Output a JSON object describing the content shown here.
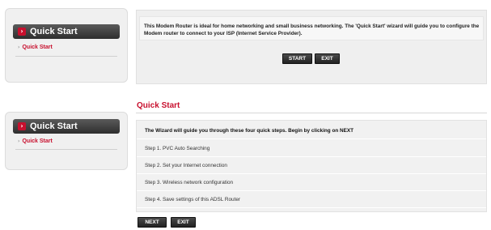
{
  "top": {
    "sidebar": {
      "header": "Quick Start",
      "items": [
        {
          "label": "Quick Start"
        }
      ]
    },
    "intro_text": "This Modem Router is ideal for home networking and small business networking. The 'Quick Start' wizard will guide you to configure the Modem router to connect to your ISP (Internet Service Provider).",
    "buttons": {
      "start": "START",
      "exit": "EXIT"
    }
  },
  "bottom": {
    "sidebar": {
      "header": "Quick Start",
      "items": [
        {
          "label": "Quick Start"
        }
      ]
    },
    "title": "Quick Start",
    "wizard_intro": "The Wizard will guide you through these four quick steps. Begin by clicking on NEXT",
    "steps": [
      "Step 1. PVC Auto Searching",
      "Step 2. Set your Internet connection",
      "Step 3. Wireless network configuration",
      "Step 4. Save settings of this ADSL Router"
    ],
    "buttons": {
      "next": "NEXT",
      "exit": "EXIT"
    }
  },
  "icons": {
    "arrow": "arrow-right-icon",
    "bullet": "bullet-icon"
  },
  "colors": {
    "accent_red": "#c8102e",
    "header_dark": "#2e2e2e"
  }
}
